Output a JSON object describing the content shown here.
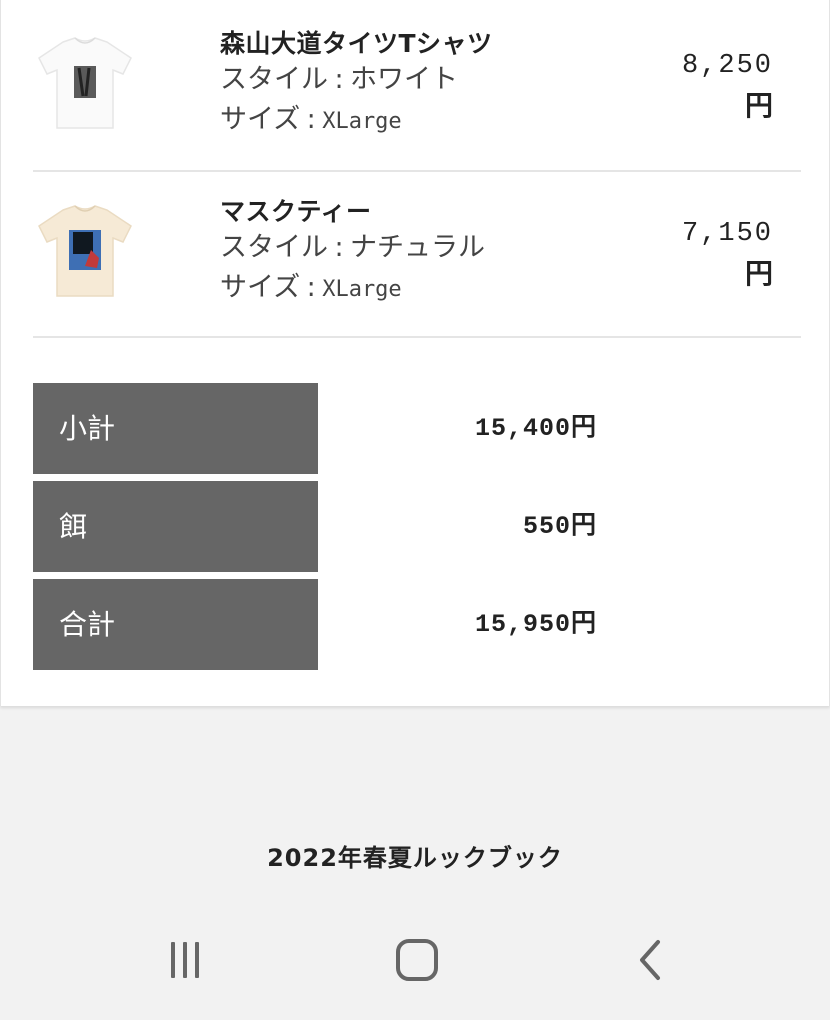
{
  "cart": {
    "items": [
      {
        "name": "森山大道タイツTシャツ",
        "style_label": "スタイル",
        "style_value": "ホワイト",
        "size_label": "サイズ",
        "size_value": "XLarge",
        "separator": ":",
        "price_number": "8,250",
        "price_unit": "円",
        "thumbnail_icon": "white-tshirt-icon"
      },
      {
        "name": "マスクティー",
        "style_label": "スタイル",
        "style_value": "ナチュラル",
        "size_label": "サイズ",
        "size_value": "XLarge",
        "separator": ":",
        "price_number": "7,150",
        "price_unit": "円",
        "thumbnail_icon": "natural-tshirt-icon"
      }
    ],
    "totals": [
      {
        "label": "小計",
        "value": "15,400円"
      },
      {
        "label": "餌",
        "value": "550円"
      },
      {
        "label": "合計",
        "value": "15,950円"
      }
    ]
  },
  "footer": {
    "lookbook_link": "2022年春夏ルックブック"
  },
  "navbar": {
    "recent_apps_icon": "recent-apps-icon",
    "home_icon": "home-icon",
    "back_icon": "back-icon"
  },
  "colors": {
    "label_bg": "#666666",
    "page_bg": "#f2f2f2",
    "card_bg": "#ffffff"
  }
}
